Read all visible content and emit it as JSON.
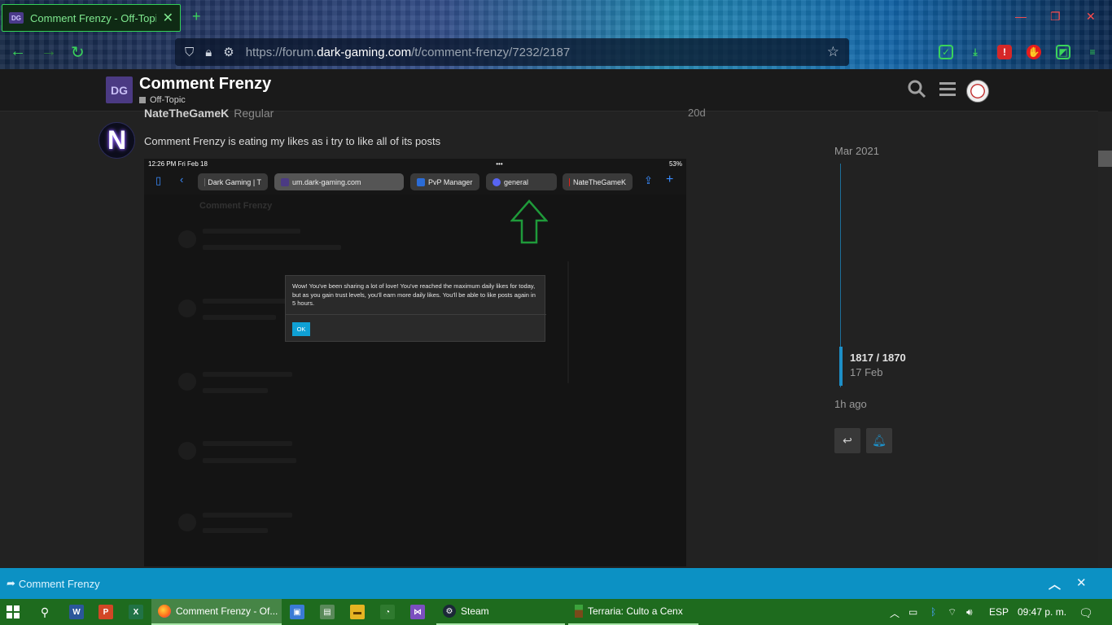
{
  "browser": {
    "tab_title": "Comment Frenzy - Off-Topic",
    "tab_favicon": "DG",
    "url_prefix": "https://forum.",
    "url_domain": "dark-gaming.com",
    "url_path": "/t/comment-frenzy/7232/2187"
  },
  "forum_header": {
    "logo": "DG",
    "title": "Comment Frenzy",
    "category": "Off-Topic"
  },
  "post": {
    "username": "NateTheGameK",
    "user_title": "Regular",
    "age": "20d",
    "avatar_letter": "N",
    "text": "Comment Frenzy is eating my likes as i try to like all of its posts"
  },
  "embedded_screenshot": {
    "time": "12:26 PM   Fri Feb 18",
    "battery": "53%",
    "dots": "•••",
    "tabs": [
      {
        "label": "Dark Gaming | T"
      },
      {
        "label": "um.dark-gaming.com"
      },
      {
        "label": "PvP Manager"
      },
      {
        "label": "general"
      },
      {
        "label": "NateTheGameK"
      }
    ],
    "ghost_title": "Comment Frenzy",
    "modal_text": "Wow! You've been sharing a lot of love! You've reached the maximum daily likes for today, but as you gain trust levels, you'll earn more daily likes. You'll be able to like posts again in 5 hours.",
    "modal_ok": "OK"
  },
  "timeline": {
    "start": "Mar 2021",
    "position": "1817 / 1870",
    "position_date": "17 Feb",
    "end": "1h ago"
  },
  "composer": {
    "label": "Comment Frenzy"
  },
  "taskbar": {
    "browser_window": "Comment Frenzy - Of...",
    "steam": "Steam",
    "terraria": "Terraria: Culto a Cenx",
    "language": "ESP",
    "clock": "09:47 p. m."
  },
  "colors": {
    "accent": "#0c91c4",
    "taskbar": "#1e6b1e",
    "browser_accent": "#3ad35b"
  }
}
